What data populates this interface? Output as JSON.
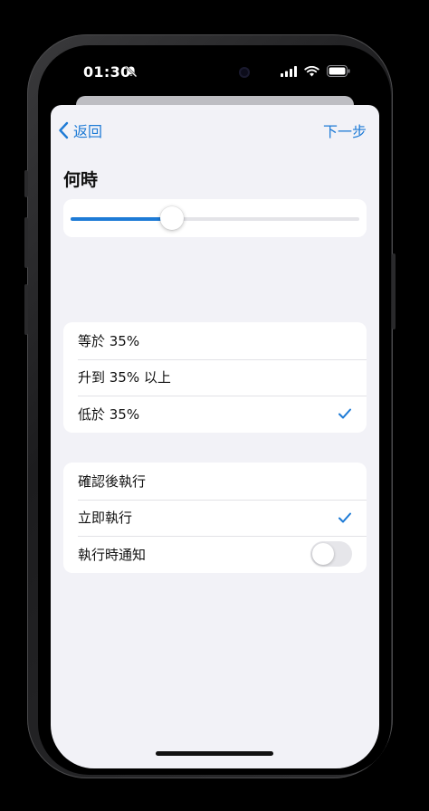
{
  "status_bar": {
    "time": "01:30"
  },
  "nav": {
    "back_label": "返回",
    "next_label": "下一步"
  },
  "when_section": {
    "title": "何時",
    "slider_value_percent": 35
  },
  "condition_options": [
    {
      "label": "等於 35%",
      "selected": false
    },
    {
      "label": "升到 35% 以上",
      "selected": false
    },
    {
      "label": "低於 35%",
      "selected": true
    }
  ],
  "execution_options": [
    {
      "label": "確認後執行",
      "selected": false
    },
    {
      "label": "立即執行",
      "selected": true
    }
  ],
  "notify_row": {
    "label": "執行時通知",
    "toggle_on": false
  },
  "colors": {
    "accent": "#1e7bd6",
    "background": "#f2f2f7",
    "card": "#ffffff"
  }
}
